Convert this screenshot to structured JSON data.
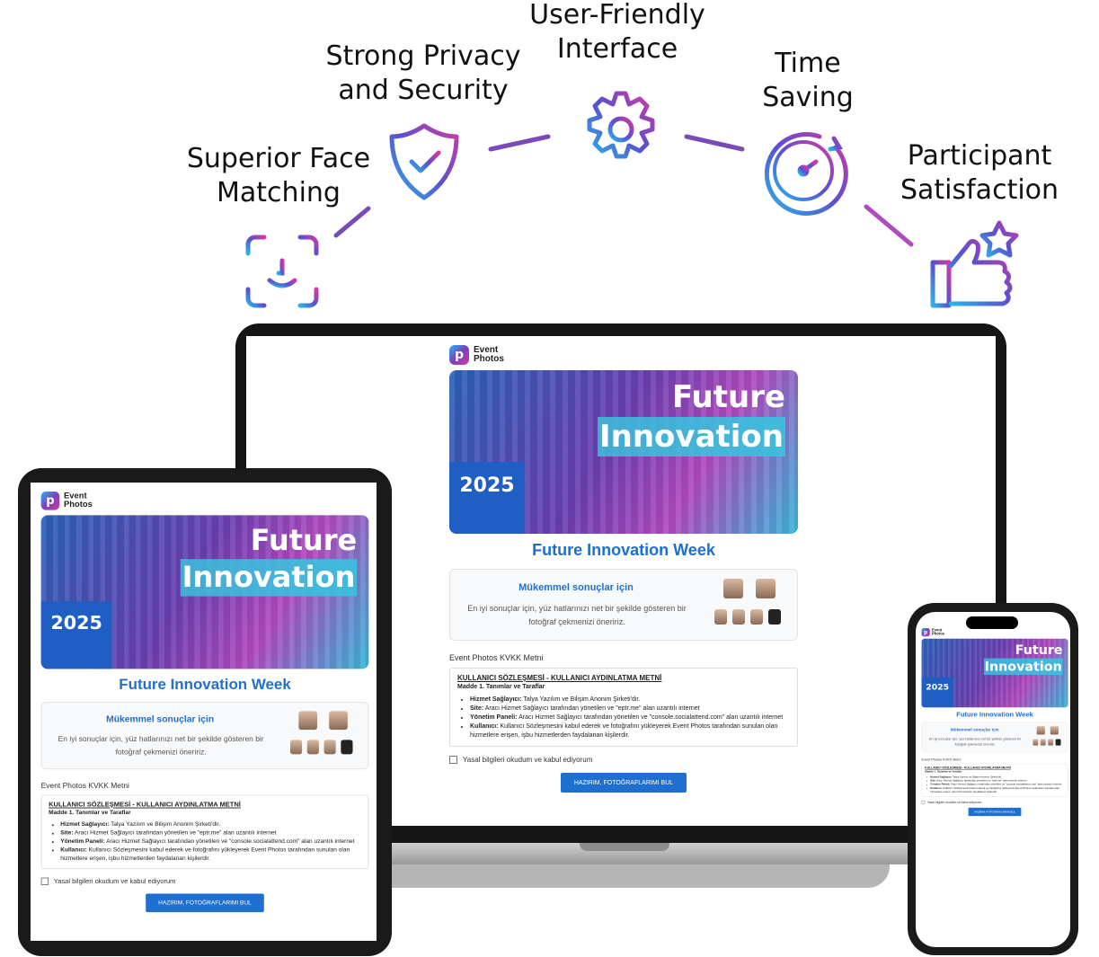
{
  "features": [
    {
      "line1": "Superior Face",
      "line2": "Matching",
      "icon": "face-id-icon"
    },
    {
      "line1": "Strong Privacy",
      "line2": "and Security",
      "icon": "shield-check-icon"
    },
    {
      "line1": "User-Friendly",
      "line2": "Interface",
      "icon": "gear-icon"
    },
    {
      "line1": "Time",
      "line2": "Saving",
      "icon": "clock-icon"
    },
    {
      "line1": "Participant",
      "line2": "Satisfaction",
      "icon": "thumbs-up-star-icon"
    }
  ],
  "app": {
    "logo_line1": "Event",
    "logo_line2": "Photos",
    "banner_line1": "Future",
    "banner_line2": "Innovation",
    "banner_year": "2025",
    "event_title": "Future Innovation Week",
    "tip_title": "Mükemmel sonuçlar için",
    "tip_text": "En iyi sonuçlar için, yüz hatlarınızı net bir şekilde gösteren bir fotoğraf çekmenizi öneririz.",
    "kvkk_label": "Event Photos KVKK Metni",
    "kvkk_heading": "KULLANICI SÖZLEŞMESİ - KULLANICI AYDINLATMA METNİ",
    "kvkk_madde": "Madde 1. Tanımlar ve Taraflar",
    "kvkk_items": [
      {
        "b": "Hizmet Sağlayıcı:",
        "t": " Talya Yazılım ve Bilişim Anonim Şirketi'dir."
      },
      {
        "b": "Site:",
        "t": " Aracı Hizmet Sağlayıcı tarafından yönetilen ve \"eptr.me\" alan uzantılı internet"
      },
      {
        "b": "Yönetim Paneli:",
        "t": " Aracı Hizmet Sağlayıcı tarafından yönetilen ve \"console.socialattend.com\" alan uzantılı internet"
      },
      {
        "b": "Kullanıcı:",
        "t": " Kullanıcı Sözleşmesini kabul ederek ve fotoğrafını yükleyerek Event Photos tarafından sunulan olan hizmetlere erişen, işbu hizmetlerden faydalanan kişilerdir."
      }
    ],
    "agree_text": "Yasal bilgileri okudum ve kabul ediyorum",
    "cta_label": "HAZIRIM, FOTOĞRAFLARIMI BUL"
  },
  "colors": {
    "accent": "#1f6fd1",
    "gradient_start": "#2bb3e8",
    "gradient_mid": "#7b3fc4",
    "gradient_end": "#d23aa0"
  }
}
